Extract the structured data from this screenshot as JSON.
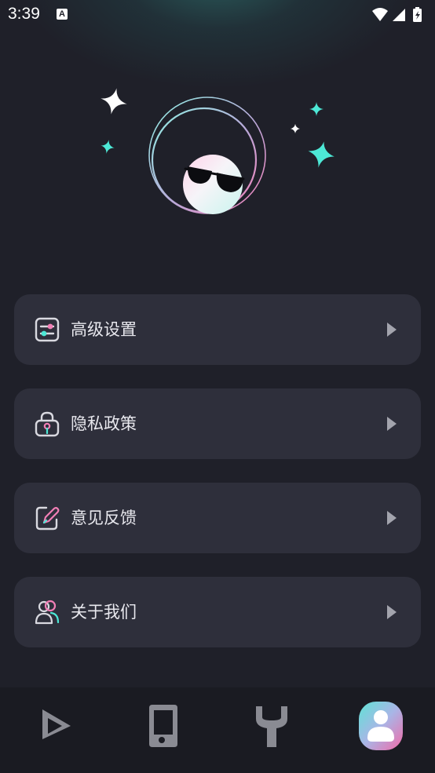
{
  "status_bar": {
    "time": "3:39",
    "notification_badge": "A"
  },
  "menu": {
    "items": [
      {
        "label": "高级设置",
        "icon": "sliders-settings-icon"
      },
      {
        "label": "隐私政策",
        "icon": "lock-key-icon"
      },
      {
        "label": "意见反馈",
        "icon": "edit-feedback-icon"
      },
      {
        "label": "关于我们",
        "icon": "people-icon"
      }
    ]
  },
  "tab_bar": {
    "tabs": [
      {
        "icon": "play-triangle-icon",
        "active": false
      },
      {
        "icon": "phone-device-icon",
        "active": false
      },
      {
        "icon": "wrench-tool-icon",
        "active": false
      },
      {
        "icon": "user-profile-icon",
        "active": true
      }
    ]
  },
  "colors": {
    "background": "#1f2029",
    "card": "#2e2f3b",
    "accent_teal": "#4de8d6",
    "accent_pink": "#f27fb6",
    "tab_inactive": "#8a8b93"
  }
}
